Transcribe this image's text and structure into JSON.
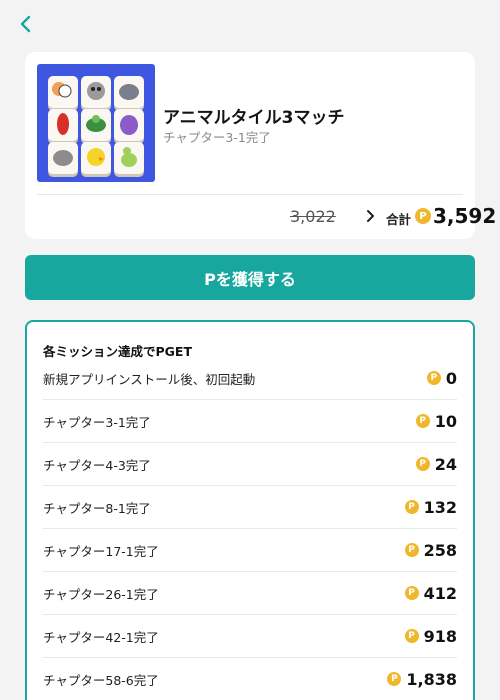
{
  "nav": {
    "back_icon": "chevron-left-icon",
    "accent": "#17a79f"
  },
  "app": {
    "title": "アニマルタイル3マッチ",
    "subtitle": "チャプター3-1完了",
    "thumbnail": "animal-tile-game-icon",
    "old_price": "3,022",
    "total_label": "合計",
    "total_value": "3,592",
    "coin_symbol": "P",
    "coin_color": "#f1b72c"
  },
  "cta": {
    "label": "Pを獲得する",
    "color": "#17a79f"
  },
  "missions": {
    "title": "各ミッション達成でPGET",
    "items": [
      {
        "label": "新規アプリインストール後、初回起動",
        "points": "0"
      },
      {
        "label": "チャプター3-1完了",
        "points": "10"
      },
      {
        "label": "チャプター4-3完了",
        "points": "24"
      },
      {
        "label": "チャプター8-1完了",
        "points": "132"
      },
      {
        "label": "チャプター17-1完了",
        "points": "258"
      },
      {
        "label": "チャプター26-1完了",
        "points": "412"
      },
      {
        "label": "チャプター42-1完了",
        "points": "918"
      },
      {
        "label": "チャプター58-6完了",
        "points": "1,838"
      }
    ]
  }
}
